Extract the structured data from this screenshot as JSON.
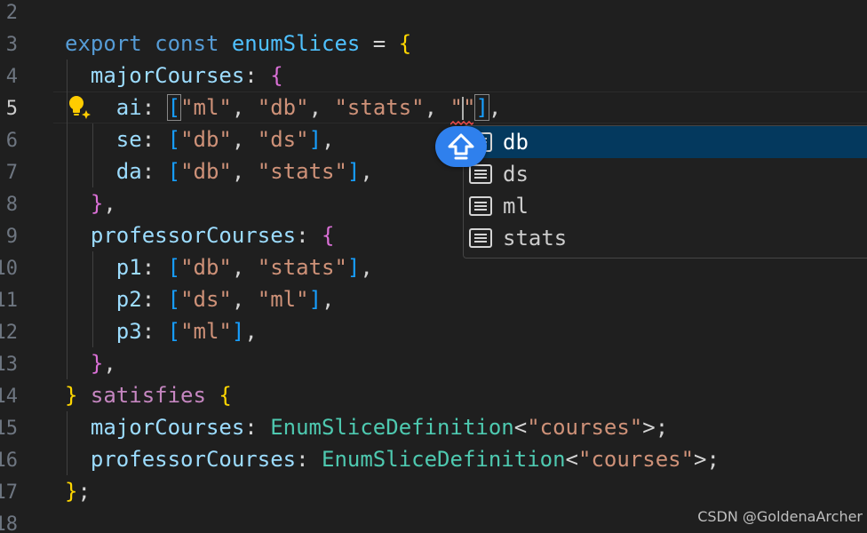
{
  "gutter": {
    "line_numbers": [
      "2",
      "3",
      "4",
      "5",
      "6",
      "7",
      "8",
      "9",
      "10",
      "11",
      "12",
      "13",
      "14",
      "15",
      "16",
      "17",
      "18"
    ],
    "active_line": "5"
  },
  "code": {
    "l3": {
      "export": "export",
      "const": "const",
      "name": "enumSlices",
      "eq": " = ",
      "brace": "{"
    },
    "l4": {
      "key": "majorCourses",
      "colon": ": ",
      "brace": "{"
    },
    "l5": {
      "key": "ai",
      "colon": ": ",
      "open": "[",
      "s1": "\"ml\"",
      "c1": ", ",
      "s2": "\"db\"",
      "c2": ", ",
      "s3": "\"stats\"",
      "c3": ", ",
      "q1": "\"",
      "q2": "\"",
      "close": "]",
      "end": ","
    },
    "l6": {
      "key": "se",
      "colon": ": ",
      "open": "[",
      "s1": "\"db\"",
      "c1": ", ",
      "s2": "\"ds\"",
      "close": "]",
      "end": ","
    },
    "l7": {
      "key": "da",
      "colon": ": ",
      "open": "[",
      "s1": "\"db\"",
      "c1": ", ",
      "s2": "\"stats\"",
      "close": "]",
      "end": ","
    },
    "l8": {
      "brace": "}",
      "end": ","
    },
    "l9": {
      "key": "professorCourses",
      "colon": ": ",
      "brace": "{"
    },
    "l10": {
      "key": "p1",
      "colon": ": ",
      "open": "[",
      "s1": "\"db\"",
      "c1": ", ",
      "s2": "\"stats\"",
      "close": "]",
      "end": ","
    },
    "l11": {
      "key": "p2",
      "colon": ": ",
      "open": "[",
      "s1": "\"ds\"",
      "c1": ", ",
      "s2": "\"ml\"",
      "close": "]",
      "end": ","
    },
    "l12": {
      "key": "p3",
      "colon": ": ",
      "open": "[",
      "s1": "\"ml\"",
      "close": "]",
      "end": ","
    },
    "l13": {
      "brace": "}",
      "end": ","
    },
    "l14": {
      "brace": "}",
      "kw": "satisfies",
      "brace2": "{"
    },
    "l15": {
      "key": "majorCourses",
      "colon": ": ",
      "type": "EnumSliceDefinition",
      "lt": "<",
      "str": "\"courses\"",
      "gt": ">",
      "end": ";"
    },
    "l16": {
      "key": "professorCourses",
      "colon": ": ",
      "type": "EnumSliceDefinition",
      "lt": "<",
      "str": "\"courses\"",
      "gt": ">",
      "end": ";"
    },
    "l17": {
      "brace": "}",
      "end": ";"
    }
  },
  "suggestions": {
    "items": [
      {
        "label": "db",
        "icon": "enum-member-icon",
        "selected": true
      },
      {
        "label": "ds",
        "icon": "enum-member-icon",
        "selected": false
      },
      {
        "label": "ml",
        "icon": "enum-member-icon",
        "selected": false
      },
      {
        "label": "stats",
        "icon": "enum-member-icon",
        "selected": false
      }
    ]
  },
  "floating_button": {
    "icon": "shift-up-arrow-icon",
    "color": "#2f80ed"
  },
  "lightbulb": {
    "icon": "lightbulb-sparkle-icon",
    "color": "#ffcc00"
  },
  "watermark": {
    "text": "CSDN @GoldenaArcher"
  },
  "colors": {
    "background": "#1f1f1f",
    "keyword": "#569cd6",
    "control_keyword": "#c586c0",
    "string": "#ce9178",
    "property": "#9cdcfe",
    "type": "#4ec9b0",
    "bracket_level1": "#ffd700",
    "bracket_level2": "#da70d6",
    "bracket_level3": "#179fff",
    "suggest_selected": "#04395e"
  }
}
